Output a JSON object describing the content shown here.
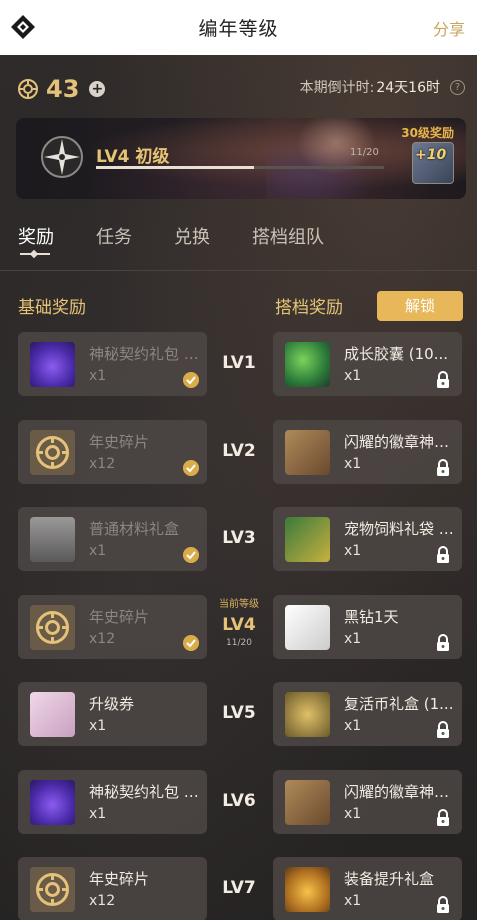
{
  "header": {
    "title": "编年等级",
    "share": "分享"
  },
  "currency": {
    "value": "43"
  },
  "countdown": {
    "label": "本期倒计时:",
    "value": "24天16时"
  },
  "banner": {
    "level_text": "LV4 初级",
    "progress_text": "11/20",
    "progress_fraction": 0.55,
    "reward_label": "30级奖励",
    "reward_badge": "+10"
  },
  "tabs": [
    {
      "label": "奖励"
    },
    {
      "label": "任务"
    },
    {
      "label": "兑换"
    },
    {
      "label": "搭档组队"
    }
  ],
  "sections": {
    "basic": "基础奖励",
    "partner": "搭档奖励",
    "unlock": "解锁"
  },
  "current_level": {
    "label": "当前等级",
    "progress": "11/20"
  },
  "rows": [
    {
      "lv": "LV1",
      "left": {
        "name": "神秘契约礼包 (1...",
        "qty": "x1",
        "icon": "bag-icon"
      },
      "right": {
        "name": "成长胶囊 (10...",
        "qty": "x1",
        "icon": "exp-capsule-icon"
      }
    },
    {
      "lv": "LV2",
      "left": {
        "name": "年史碎片",
        "qty": "x12",
        "icon": "token-icon"
      },
      "right": {
        "name": "闪耀的徽章神秘...",
        "qty": "x1",
        "icon": "medal-chest-icon"
      }
    },
    {
      "lv": "LV3",
      "left": {
        "name": "普通材料礼盒",
        "qty": "x1",
        "icon": "chest-icon"
      },
      "right": {
        "name": "宠物饲料礼袋 (1...",
        "qty": "x1",
        "icon": "feed-bag-icon"
      }
    },
    {
      "lv": "LV4",
      "left": {
        "name": "年史碎片",
        "qty": "x12",
        "icon": "token-icon"
      },
      "right": {
        "name": "黑钻1天",
        "qty": "x1",
        "icon": "diamond-icon"
      }
    },
    {
      "lv": "LV5",
      "left": {
        "name": "升级券",
        "qty": "x1",
        "icon": "ticket-icon"
      },
      "right": {
        "name": "复活币礼盒 (1...",
        "qty": "x1",
        "icon": "revive-coin-icon"
      }
    },
    {
      "lv": "LV6",
      "left": {
        "name": "神秘契约礼包 (1...",
        "qty": "x1",
        "icon": "bag-icon"
      },
      "right": {
        "name": "闪耀的徽章神秘...",
        "qty": "x1",
        "icon": "medal-chest-icon"
      }
    },
    {
      "lv": "LV7",
      "left": {
        "name": "年史碎片",
        "qty": "x12",
        "icon": "token-icon"
      },
      "right": {
        "name": "装备提升礼盒",
        "qty": "x1",
        "icon": "equip-chest-icon"
      }
    }
  ]
}
